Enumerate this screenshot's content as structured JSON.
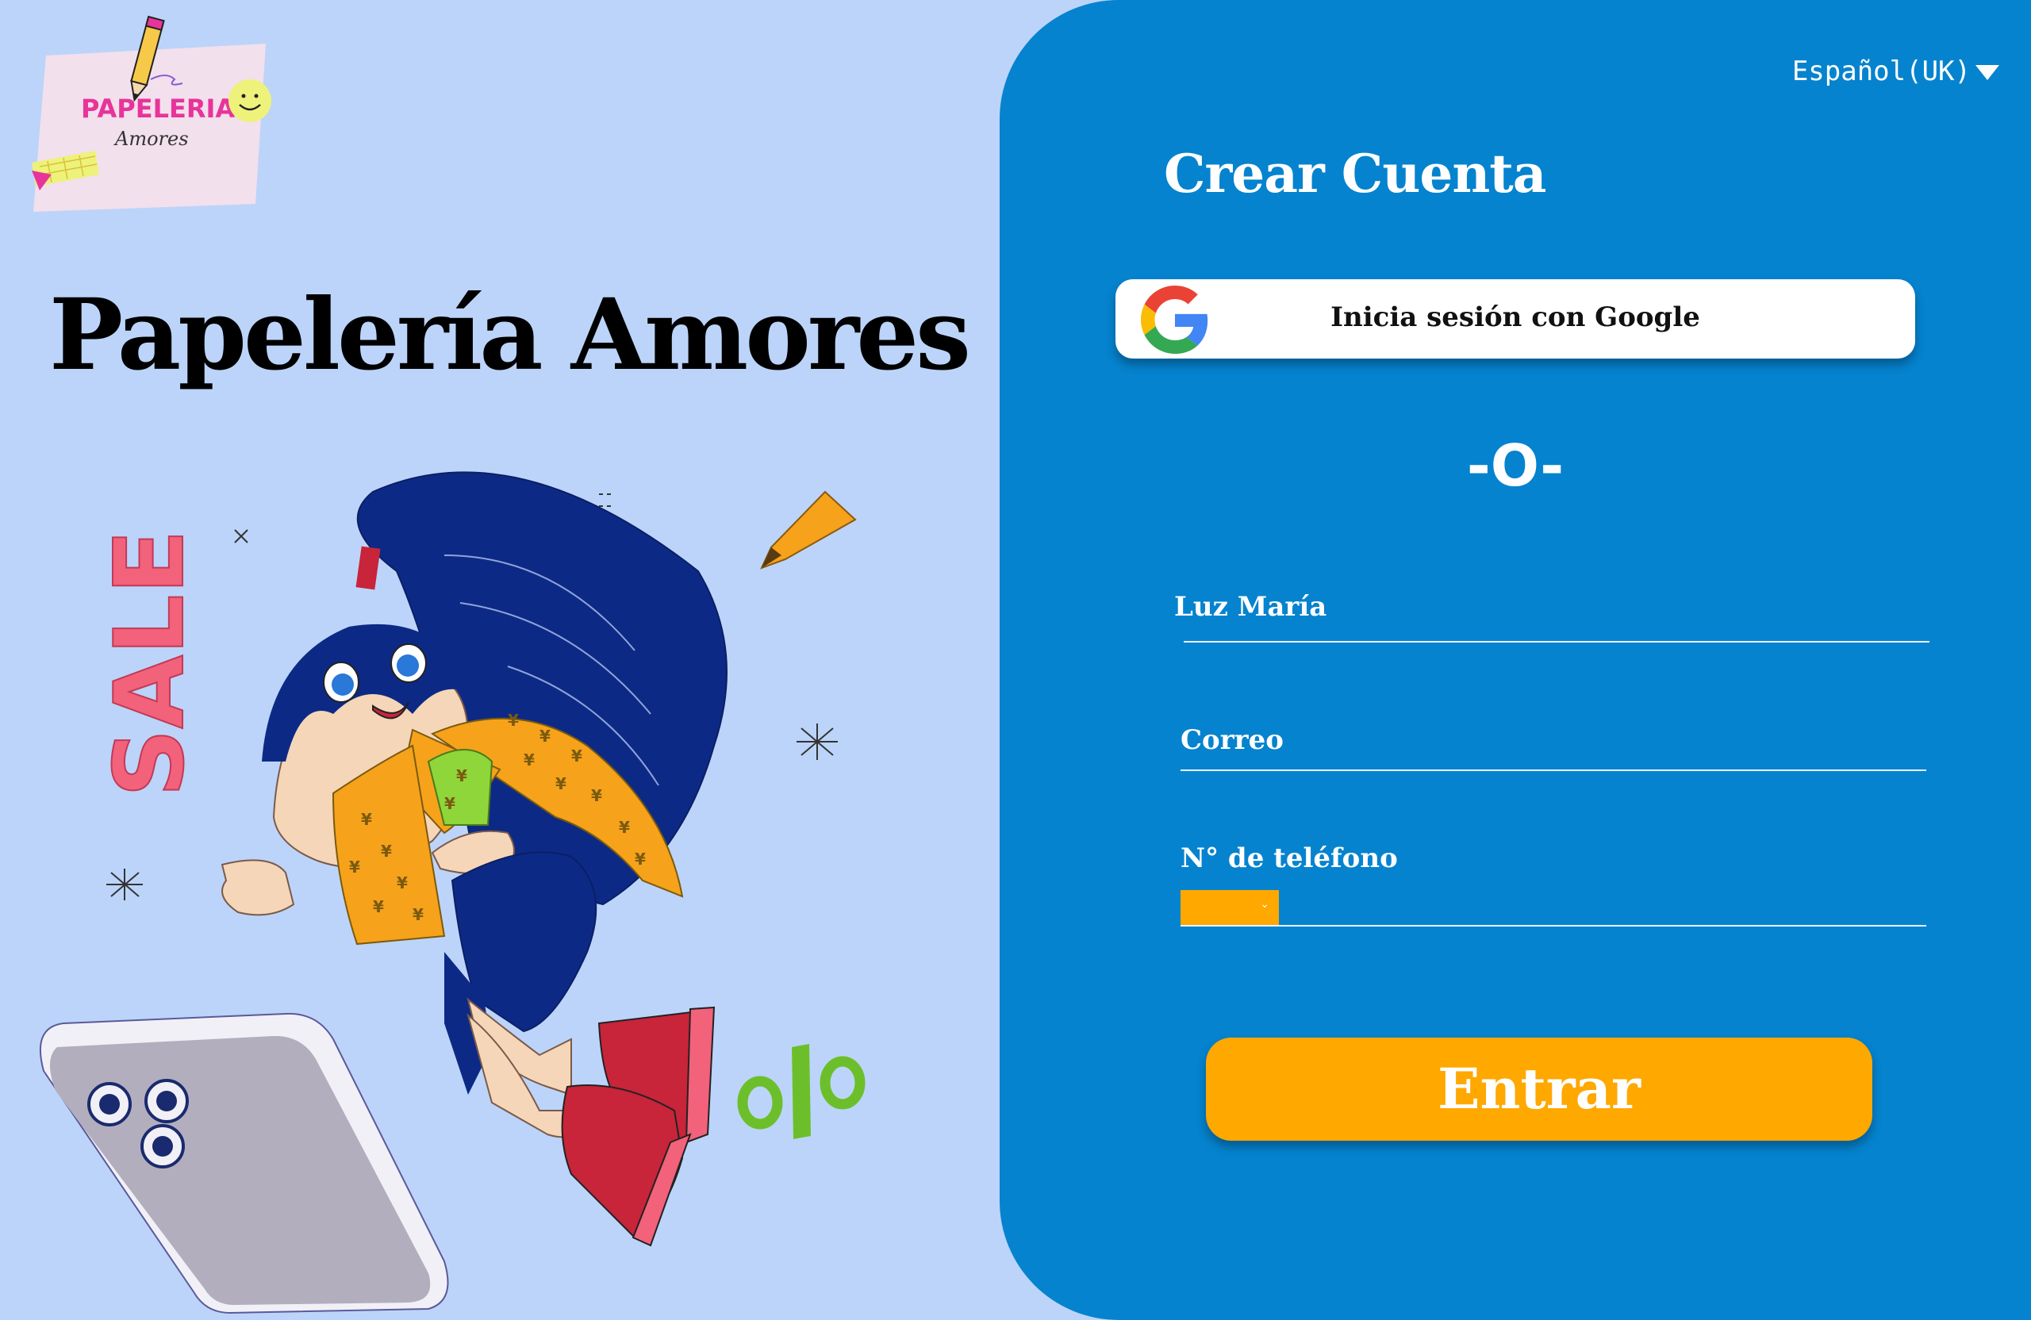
{
  "logo": {
    "line1": "PAPELERIA",
    "line2": "Amores"
  },
  "brand": {
    "title": "Papelería Amores"
  },
  "illustration": {
    "sale_text": "SALE",
    "percent_symbol": "%"
  },
  "language": {
    "label": "Español(UK)"
  },
  "form": {
    "title": "Crear Cuenta",
    "google_button": "Inicia sesión con Google",
    "separator": "-O-",
    "fields": [
      {
        "label": "Luz María",
        "value": ""
      },
      {
        "label": "Correo",
        "value": ""
      },
      {
        "label": "N° de teléfono",
        "value": ""
      }
    ],
    "submit": "Entrar"
  },
  "colors": {
    "page_background": "#bcd4f9",
    "panel_background": "#0583cf",
    "accent": "#fea800",
    "logo_pink": "#e8349a"
  },
  "icons": [
    "pencil-icon",
    "smiley-icon",
    "google-icon",
    "caret-down-icon"
  ]
}
